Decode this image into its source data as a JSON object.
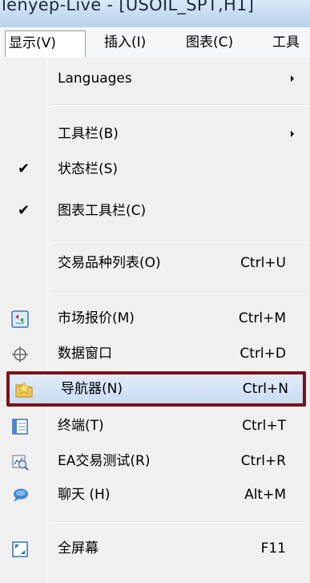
{
  "window": {
    "title": "lenyep-Live - [USOIL_SPT,H1]"
  },
  "menubar": {
    "items": [
      {
        "label": "显示(V)"
      },
      {
        "label": "插入(I)"
      },
      {
        "label": "图表(C)"
      },
      {
        "label": "工具"
      }
    ]
  },
  "view_menu": {
    "languages": {
      "label": "Languages",
      "icon": "submenu-arrow"
    },
    "toolbars": {
      "label": "工具栏(B)",
      "icon": "submenu-arrow"
    },
    "status_bar": {
      "label": "状态栏(S)",
      "checked": true
    },
    "chart_toolbar": {
      "label": "图表工具栏(C)",
      "checked": true
    },
    "symbols": {
      "label": "交易品种列表(O)",
      "shortcut": "Ctrl+U"
    },
    "market_watch": {
      "label": "市场报价(M)",
      "shortcut": "Ctrl+M",
      "icon": "market-watch-icon"
    },
    "data_window": {
      "label": "数据窗口",
      "shortcut": "Ctrl+D",
      "icon": "crosshair-icon"
    },
    "navigator": {
      "label": "导航器(N)",
      "shortcut": "Ctrl+N",
      "icon": "navigator-star-icon",
      "highlighted": true
    },
    "terminal": {
      "label": "终端(T)",
      "shortcut": "Ctrl+T",
      "icon": "terminal-icon"
    },
    "strategy_tester": {
      "label": "EA交易测试(R)",
      "shortcut": "Ctrl+R",
      "icon": "tester-icon"
    },
    "chat": {
      "label": "聊天 (H)",
      "shortcut": "Alt+M",
      "icon": "chat-icon"
    },
    "fullscreen": {
      "label": "全屏幕",
      "shortcut": "F11",
      "icon": "fullscreen-icon"
    }
  },
  "colors": {
    "highlight_border": "#7a1219",
    "highlight_fill": "#c9dcf2",
    "menu_background": "#f0f0f0"
  }
}
